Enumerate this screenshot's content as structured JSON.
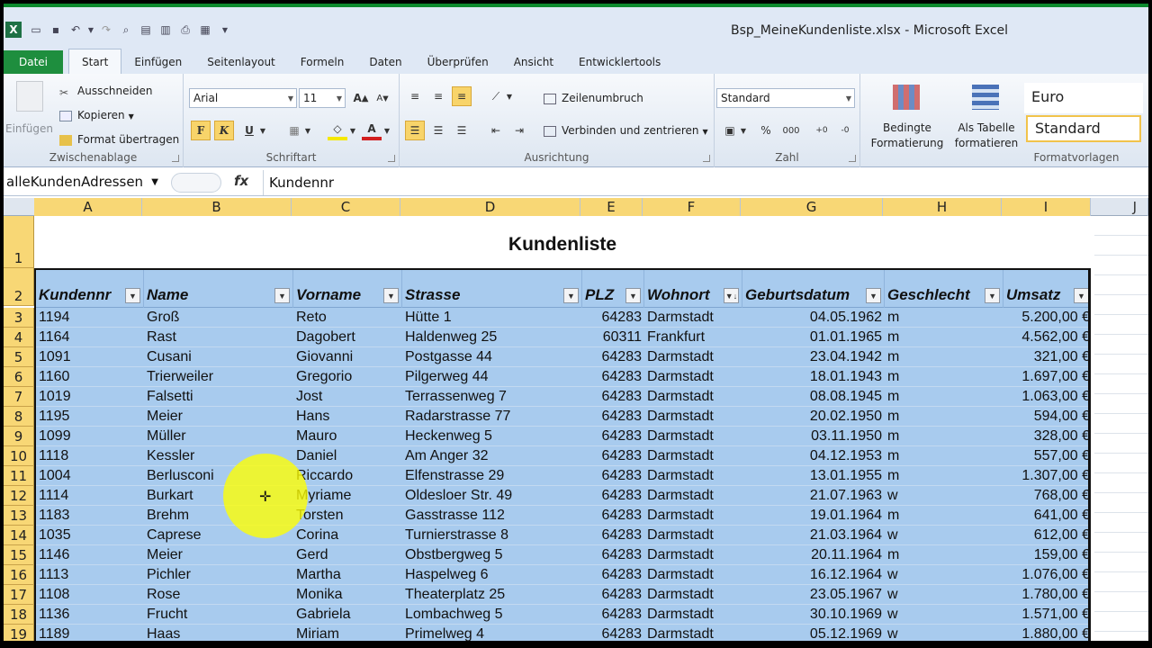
{
  "window": {
    "title": "Bsp_MeineKundenliste.xlsx - Microsoft Excel"
  },
  "tabs": [
    "Datei",
    "Start",
    "Einfügen",
    "Seitenlayout",
    "Formeln",
    "Daten",
    "Überprüfen",
    "Ansicht",
    "Entwicklertools"
  ],
  "ribbon": {
    "clipboard": {
      "paste": "Einfügen",
      "cut": "Ausschneiden",
      "copy": "Kopieren",
      "format_painter": "Format übertragen",
      "label": "Zwischenablage"
    },
    "font": {
      "name": "Arial",
      "size": "11",
      "bold": "F",
      "italic": "K",
      "underline": "U",
      "label": "Schriftart"
    },
    "alignment": {
      "wrap": "Zeilenumbruch",
      "merge": "Verbinden und zentrieren",
      "label": "Ausrichtung"
    },
    "number": {
      "format": "Standard",
      "percent": "%",
      "thousands": "000",
      "label": "Zahl"
    },
    "styles": {
      "conditional": "Bedingte\nFormatierung",
      "conditional_l1": "Bedingte",
      "conditional_l2": "Formatierung",
      "as_table_l1": "Als Tabelle",
      "as_table_l2": "formatieren",
      "style1": "Euro",
      "style2": "Standard",
      "label": "Formatvorlagen"
    }
  },
  "formula_bar": {
    "name_box": "alleKundenAdressen",
    "fx": "fx",
    "value": "Kundennr"
  },
  "columns": [
    "A",
    "B",
    "C",
    "D",
    "E",
    "F",
    "G",
    "H",
    "I",
    "J"
  ],
  "sheet_title": "Kundenliste",
  "table": {
    "headers": [
      "Kundennr",
      "Name",
      "Vorname",
      "Strasse",
      "PLZ",
      "Wohnort",
      "Geburtsdatum",
      "Geschlecht",
      "Umsatz"
    ],
    "rows": [
      [
        "1194",
        "Groß",
        "Reto",
        "Hütte 1",
        "64283",
        "Darmstadt",
        "04.05.1962",
        "m",
        "5.200,00 €"
      ],
      [
        "1164",
        "Rast",
        "Dagobert",
        "Haldenweg 25",
        "60311",
        "Frankfurt",
        "01.01.1965",
        "m",
        "4.562,00 €"
      ],
      [
        "1091",
        "Cusani",
        "Giovanni",
        "Postgasse 44",
        "64283",
        "Darmstadt",
        "23.04.1942",
        "m",
        "321,00 €"
      ],
      [
        "1160",
        "Trierweiler",
        "Gregorio",
        "Pilgerweg 44",
        "64283",
        "Darmstadt",
        "18.01.1943",
        "m",
        "1.697,00 €"
      ],
      [
        "1019",
        "Falsetti",
        "Jost",
        "Terrassenweg 7",
        "64283",
        "Darmstadt",
        "08.08.1945",
        "m",
        "1.063,00 €"
      ],
      [
        "1195",
        "Meier",
        "Hans",
        "Radarstrasse 77",
        "64283",
        "Darmstadt",
        "20.02.1950",
        "m",
        "594,00 €"
      ],
      [
        "1099",
        "Müller",
        "Mauro",
        "Heckenweg 5",
        "64283",
        "Darmstadt",
        "03.11.1950",
        "m",
        "328,00 €"
      ],
      [
        "1118",
        "Kessler",
        "Daniel",
        "Am Anger 32",
        "64283",
        "Darmstadt",
        "04.12.1953",
        "m",
        "557,00 €"
      ],
      [
        "1004",
        "Berlusconi",
        "Riccardo",
        "Elfenstrasse 29",
        "64283",
        "Darmstadt",
        "13.01.1955",
        "m",
        "1.307,00 €"
      ],
      [
        "1114",
        "Burkart",
        "Myriame",
        "Oldesloer Str. 49",
        "64283",
        "Darmstadt",
        "21.07.1963",
        "w",
        "768,00 €"
      ],
      [
        "1183",
        "Brehm",
        "Torsten",
        "Gasstrasse 112",
        "64283",
        "Darmstadt",
        "19.01.1964",
        "m",
        "641,00 €"
      ],
      [
        "1035",
        "Caprese",
        "Corina",
        "Turnierstrasse 8",
        "64283",
        "Darmstadt",
        "21.03.1964",
        "w",
        "612,00 €"
      ],
      [
        "1146",
        "Meier",
        "Gerd",
        "Obstbergweg 5",
        "64283",
        "Darmstadt",
        "20.11.1964",
        "m",
        "159,00 €"
      ],
      [
        "1113",
        "Pichler",
        "Martha",
        "Haspelweg 6",
        "64283",
        "Darmstadt",
        "16.12.1964",
        "w",
        "1.076,00 €"
      ],
      [
        "1108",
        "Rose",
        "Monika",
        "Theaterplatz 25",
        "64283",
        "Darmstadt",
        "23.05.1967",
        "w",
        "1.780,00 €"
      ],
      [
        "1136",
        "Frucht",
        "Gabriela",
        "Lombachweg 5",
        "64283",
        "Darmstadt",
        "30.10.1969",
        "w",
        "1.571,00 €"
      ],
      [
        "1189",
        "Haas",
        "Miriam",
        "Primelweg 4",
        "64283",
        "Darmstadt",
        "05.12.1969",
        "w",
        "1.880,00 €"
      ]
    ]
  },
  "row_numbers": [
    "1",
    "2",
    "3",
    "4",
    "5",
    "6",
    "7",
    "8",
    "9",
    "10",
    "11",
    "12",
    "13",
    "14",
    "15",
    "16",
    "17",
    "18",
    "19"
  ]
}
